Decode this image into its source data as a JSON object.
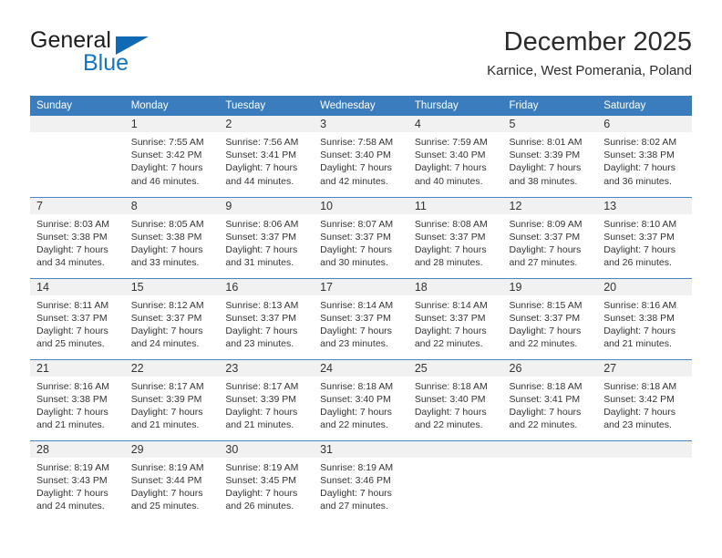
{
  "brand": {
    "name_part1": "General",
    "name_part2": "Blue",
    "triangle_color": "#1069b4",
    "blue_color": "#1275c4"
  },
  "header": {
    "title": "December 2025",
    "subtitle": "Karnice, West Pomerania, Poland"
  },
  "theme": {
    "header_row_bg": "#3a7cbe",
    "daynum_band_bg": "#f1f1f1",
    "row_divider": "#4a86c5",
    "text": "#333333"
  },
  "weekday_headers": [
    "Sunday",
    "Monday",
    "Tuesday",
    "Wednesday",
    "Thursday",
    "Friday",
    "Saturday"
  ],
  "weeks": [
    [
      {
        "day": "",
        "blank": true,
        "sunrise": "",
        "sunset": "",
        "daylight_line1": "",
        "daylight_line2": ""
      },
      {
        "day": "1",
        "blank": false,
        "sunrise": "Sunrise: 7:55 AM",
        "sunset": "Sunset: 3:42 PM",
        "daylight_line1": "Daylight: 7 hours",
        "daylight_line2": "and 46 minutes."
      },
      {
        "day": "2",
        "blank": false,
        "sunrise": "Sunrise: 7:56 AM",
        "sunset": "Sunset: 3:41 PM",
        "daylight_line1": "Daylight: 7 hours",
        "daylight_line2": "and 44 minutes."
      },
      {
        "day": "3",
        "blank": false,
        "sunrise": "Sunrise: 7:58 AM",
        "sunset": "Sunset: 3:40 PM",
        "daylight_line1": "Daylight: 7 hours",
        "daylight_line2": "and 42 minutes."
      },
      {
        "day": "4",
        "blank": false,
        "sunrise": "Sunrise: 7:59 AM",
        "sunset": "Sunset: 3:40 PM",
        "daylight_line1": "Daylight: 7 hours",
        "daylight_line2": "and 40 minutes."
      },
      {
        "day": "5",
        "blank": false,
        "sunrise": "Sunrise: 8:01 AM",
        "sunset": "Sunset: 3:39 PM",
        "daylight_line1": "Daylight: 7 hours",
        "daylight_line2": "and 38 minutes."
      },
      {
        "day": "6",
        "blank": false,
        "sunrise": "Sunrise: 8:02 AM",
        "sunset": "Sunset: 3:38 PM",
        "daylight_line1": "Daylight: 7 hours",
        "daylight_line2": "and 36 minutes."
      }
    ],
    [
      {
        "day": "7",
        "blank": false,
        "sunrise": "Sunrise: 8:03 AM",
        "sunset": "Sunset: 3:38 PM",
        "daylight_line1": "Daylight: 7 hours",
        "daylight_line2": "and 34 minutes."
      },
      {
        "day": "8",
        "blank": false,
        "sunrise": "Sunrise: 8:05 AM",
        "sunset": "Sunset: 3:38 PM",
        "daylight_line1": "Daylight: 7 hours",
        "daylight_line2": "and 33 minutes."
      },
      {
        "day": "9",
        "blank": false,
        "sunrise": "Sunrise: 8:06 AM",
        "sunset": "Sunset: 3:37 PM",
        "daylight_line1": "Daylight: 7 hours",
        "daylight_line2": "and 31 minutes."
      },
      {
        "day": "10",
        "blank": false,
        "sunrise": "Sunrise: 8:07 AM",
        "sunset": "Sunset: 3:37 PM",
        "daylight_line1": "Daylight: 7 hours",
        "daylight_line2": "and 30 minutes."
      },
      {
        "day": "11",
        "blank": false,
        "sunrise": "Sunrise: 8:08 AM",
        "sunset": "Sunset: 3:37 PM",
        "daylight_line1": "Daylight: 7 hours",
        "daylight_line2": "and 28 minutes."
      },
      {
        "day": "12",
        "blank": false,
        "sunrise": "Sunrise: 8:09 AM",
        "sunset": "Sunset: 3:37 PM",
        "daylight_line1": "Daylight: 7 hours",
        "daylight_line2": "and 27 minutes."
      },
      {
        "day": "13",
        "blank": false,
        "sunrise": "Sunrise: 8:10 AM",
        "sunset": "Sunset: 3:37 PM",
        "daylight_line1": "Daylight: 7 hours",
        "daylight_line2": "and 26 minutes."
      }
    ],
    [
      {
        "day": "14",
        "blank": false,
        "sunrise": "Sunrise: 8:11 AM",
        "sunset": "Sunset: 3:37 PM",
        "daylight_line1": "Daylight: 7 hours",
        "daylight_line2": "and 25 minutes."
      },
      {
        "day": "15",
        "blank": false,
        "sunrise": "Sunrise: 8:12 AM",
        "sunset": "Sunset: 3:37 PM",
        "daylight_line1": "Daylight: 7 hours",
        "daylight_line2": "and 24 minutes."
      },
      {
        "day": "16",
        "blank": false,
        "sunrise": "Sunrise: 8:13 AM",
        "sunset": "Sunset: 3:37 PM",
        "daylight_line1": "Daylight: 7 hours",
        "daylight_line2": "and 23 minutes."
      },
      {
        "day": "17",
        "blank": false,
        "sunrise": "Sunrise: 8:14 AM",
        "sunset": "Sunset: 3:37 PM",
        "daylight_line1": "Daylight: 7 hours",
        "daylight_line2": "and 23 minutes."
      },
      {
        "day": "18",
        "blank": false,
        "sunrise": "Sunrise: 8:14 AM",
        "sunset": "Sunset: 3:37 PM",
        "daylight_line1": "Daylight: 7 hours",
        "daylight_line2": "and 22 minutes."
      },
      {
        "day": "19",
        "blank": false,
        "sunrise": "Sunrise: 8:15 AM",
        "sunset": "Sunset: 3:37 PM",
        "daylight_line1": "Daylight: 7 hours",
        "daylight_line2": "and 22 minutes."
      },
      {
        "day": "20",
        "blank": false,
        "sunrise": "Sunrise: 8:16 AM",
        "sunset": "Sunset: 3:38 PM",
        "daylight_line1": "Daylight: 7 hours",
        "daylight_line2": "and 21 minutes."
      }
    ],
    [
      {
        "day": "21",
        "blank": false,
        "sunrise": "Sunrise: 8:16 AM",
        "sunset": "Sunset: 3:38 PM",
        "daylight_line1": "Daylight: 7 hours",
        "daylight_line2": "and 21 minutes."
      },
      {
        "day": "22",
        "blank": false,
        "sunrise": "Sunrise: 8:17 AM",
        "sunset": "Sunset: 3:39 PM",
        "daylight_line1": "Daylight: 7 hours",
        "daylight_line2": "and 21 minutes."
      },
      {
        "day": "23",
        "blank": false,
        "sunrise": "Sunrise: 8:17 AM",
        "sunset": "Sunset: 3:39 PM",
        "daylight_line1": "Daylight: 7 hours",
        "daylight_line2": "and 21 minutes."
      },
      {
        "day": "24",
        "blank": false,
        "sunrise": "Sunrise: 8:18 AM",
        "sunset": "Sunset: 3:40 PM",
        "daylight_line1": "Daylight: 7 hours",
        "daylight_line2": "and 22 minutes."
      },
      {
        "day": "25",
        "blank": false,
        "sunrise": "Sunrise: 8:18 AM",
        "sunset": "Sunset: 3:40 PM",
        "daylight_line1": "Daylight: 7 hours",
        "daylight_line2": "and 22 minutes."
      },
      {
        "day": "26",
        "blank": false,
        "sunrise": "Sunrise: 8:18 AM",
        "sunset": "Sunset: 3:41 PM",
        "daylight_line1": "Daylight: 7 hours",
        "daylight_line2": "and 22 minutes."
      },
      {
        "day": "27",
        "blank": false,
        "sunrise": "Sunrise: 8:18 AM",
        "sunset": "Sunset: 3:42 PM",
        "daylight_line1": "Daylight: 7 hours",
        "daylight_line2": "and 23 minutes."
      }
    ],
    [
      {
        "day": "28",
        "blank": false,
        "sunrise": "Sunrise: 8:19 AM",
        "sunset": "Sunset: 3:43 PM",
        "daylight_line1": "Daylight: 7 hours",
        "daylight_line2": "and 24 minutes."
      },
      {
        "day": "29",
        "blank": false,
        "sunrise": "Sunrise: 8:19 AM",
        "sunset": "Sunset: 3:44 PM",
        "daylight_line1": "Daylight: 7 hours",
        "daylight_line2": "and 25 minutes."
      },
      {
        "day": "30",
        "blank": false,
        "sunrise": "Sunrise: 8:19 AM",
        "sunset": "Sunset: 3:45 PM",
        "daylight_line1": "Daylight: 7 hours",
        "daylight_line2": "and 26 minutes."
      },
      {
        "day": "31",
        "blank": false,
        "sunrise": "Sunrise: 8:19 AM",
        "sunset": "Sunset: 3:46 PM",
        "daylight_line1": "Daylight: 7 hours",
        "daylight_line2": "and 27 minutes."
      },
      {
        "day": "",
        "blank": true,
        "sunrise": "",
        "sunset": "",
        "daylight_line1": "",
        "daylight_line2": ""
      },
      {
        "day": "",
        "blank": true,
        "sunrise": "",
        "sunset": "",
        "daylight_line1": "",
        "daylight_line2": ""
      },
      {
        "day": "",
        "blank": true,
        "sunrise": "",
        "sunset": "",
        "daylight_line1": "",
        "daylight_line2": ""
      }
    ]
  ]
}
